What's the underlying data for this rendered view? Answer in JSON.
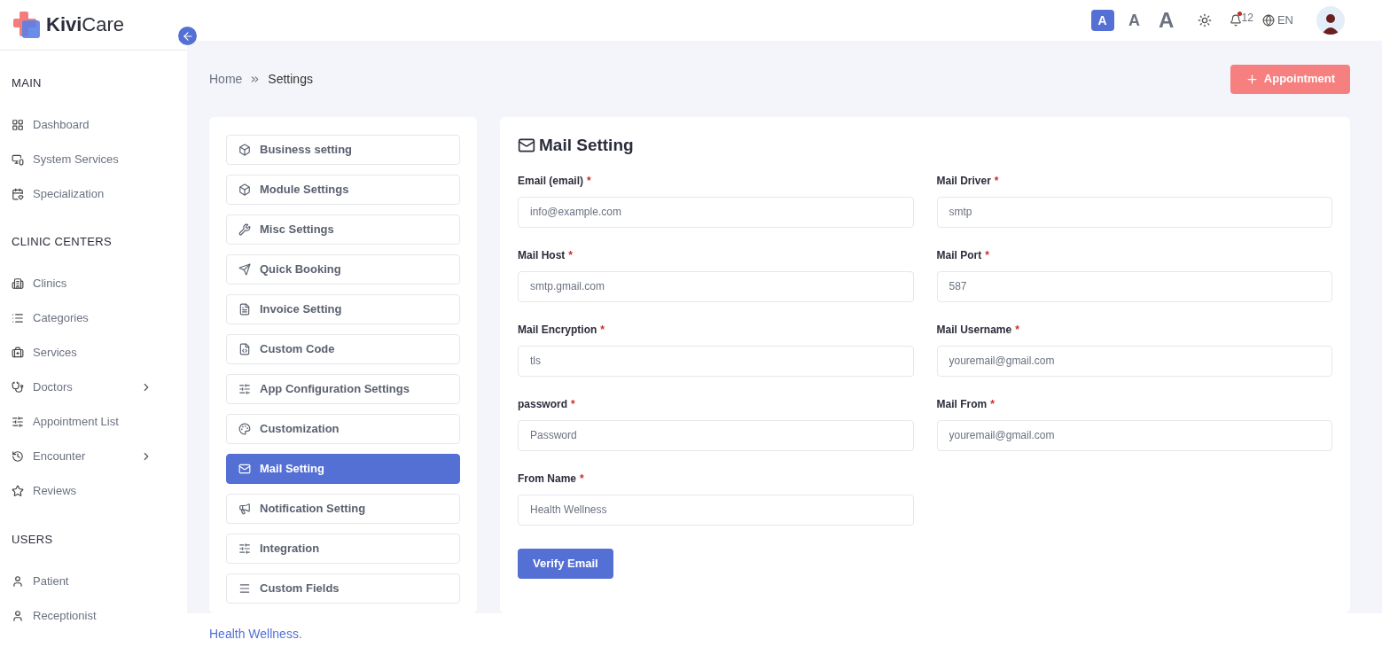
{
  "brand": {
    "name_bold": "Kivi",
    "name_light": "Care"
  },
  "topbar": {
    "font_sizes": [
      {
        "label": "A",
        "selected": true
      },
      {
        "label": "A",
        "selected": false
      },
      {
        "label": "A",
        "selected": false
      }
    ],
    "notifications": "12",
    "language": "EN"
  },
  "sidebar": {
    "sections": [
      {
        "title": "MAIN",
        "items": [
          {
            "label": "Dashboard",
            "expandable": false
          },
          {
            "label": "System Services",
            "expandable": false
          },
          {
            "label": "Specialization",
            "expandable": false
          }
        ]
      },
      {
        "title": "CLINIC CENTERS",
        "items": [
          {
            "label": "Clinics",
            "expandable": false
          },
          {
            "label": "Categories",
            "expandable": false
          },
          {
            "label": "Services",
            "expandable": false
          },
          {
            "label": "Doctors",
            "expandable": true
          },
          {
            "label": "Appointment List",
            "expandable": false
          },
          {
            "label": "Encounter",
            "expandable": true
          },
          {
            "label": "Reviews",
            "expandable": false
          }
        ]
      },
      {
        "title": "USERS",
        "items": [
          {
            "label": "Patient",
            "expandable": false
          },
          {
            "label": "Receptionist",
            "expandable": false
          }
        ]
      }
    ]
  },
  "breadcrumb": [
    "Home",
    "Settings"
  ],
  "appointment_button": "Appointment",
  "settings_menu": [
    {
      "label": "Business setting",
      "selected": false
    },
    {
      "label": "Module Settings",
      "selected": false
    },
    {
      "label": "Misc Settings",
      "selected": false
    },
    {
      "label": "Quick Booking",
      "selected": false
    },
    {
      "label": "Invoice Setting",
      "selected": false
    },
    {
      "label": "Custom Code",
      "selected": false
    },
    {
      "label": "App Configuration Settings",
      "selected": false
    },
    {
      "label": "Customization",
      "selected": false
    },
    {
      "label": "Mail Setting",
      "selected": true
    },
    {
      "label": "Notification Setting",
      "selected": false
    },
    {
      "label": "Integration",
      "selected": false
    },
    {
      "label": "Custom Fields",
      "selected": false
    }
  ],
  "form": {
    "title": "Mail Setting",
    "fields": [
      {
        "label": "Email (email)",
        "required_mark": "*",
        "value": "info@example.com"
      },
      {
        "label": "Mail Driver",
        "required_mark": "*",
        "value": "smtp"
      },
      {
        "label": "Mail Host",
        "required_mark": "*",
        "value": "smtp.gmail.com"
      },
      {
        "label": "Mail Port",
        "required_mark": "*",
        "value": "587"
      },
      {
        "label": "Mail Encryption",
        "required_mark": "*",
        "value": "tls"
      },
      {
        "label": "Mail Username",
        "required_mark": "*",
        "value": "youremail@gmail.com"
      },
      {
        "label": "password",
        "required_mark": "*",
        "placeholder": "Password"
      },
      {
        "label": "Mail From",
        "required_mark": "*",
        "value": "youremail@gmail.com"
      },
      {
        "label": "From Name",
        "required_mark": "*",
        "value": "Health Wellness"
      }
    ],
    "submit": "Verify Email"
  },
  "footer": {
    "link": "Health Wellness",
    "suffix": "."
  }
}
